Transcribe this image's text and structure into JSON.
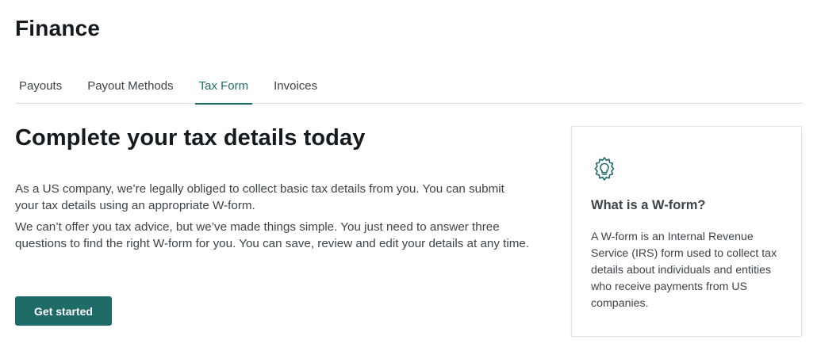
{
  "page": {
    "title": "Finance"
  },
  "tabs": [
    {
      "label": "Payouts",
      "active": false
    },
    {
      "label": "Payout Methods",
      "active": false
    },
    {
      "label": "Tax Form",
      "active": true
    },
    {
      "label": "Invoices",
      "active": false
    }
  ],
  "main": {
    "heading": "Complete your tax details today",
    "paragraph_1": "As a US company, we’re legally obliged to collect basic tax details from you. You can submit your tax details using an appropriate W-form.",
    "paragraph_2": "We can’t offer you tax advice, but we’ve made things simple. You just need to answer three questions to find the right W-form for you. You can save, review and edit your details at any time.",
    "cta_label": "Get started"
  },
  "info_card": {
    "icon": "lightbulb-gear-icon",
    "title": "What is a W-form?",
    "body": "A W-form is an Internal Revenue Service (IRS) form used to collect tax details about individuals and entities who receive payments from US companies."
  },
  "colors": {
    "accent": "#1f6b68",
    "text": "#3d4449",
    "heading": "#151a1e",
    "divider": "#d9dcde"
  }
}
